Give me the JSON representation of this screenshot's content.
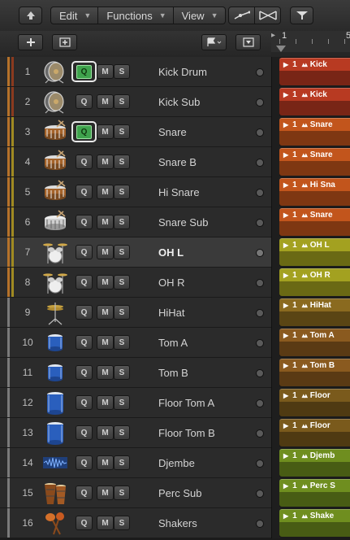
{
  "toolbar": {
    "menus": [
      {
        "label": "Edit"
      },
      {
        "label": "Functions"
      },
      {
        "label": "View"
      }
    ]
  },
  "ruler": {
    "marks": [
      "1",
      "5"
    ]
  },
  "colors": {
    "orange_region": "#c2551c",
    "red_region": "#b83a22",
    "yellow_region": "#a3a120",
    "brown_region": "#8a5a1f",
    "green_region": "#6f8e1f",
    "q_active": "#3fa34d"
  },
  "tracks": [
    {
      "num": "1",
      "name": "Kick Drum",
      "icon": "kick-drum-icon",
      "q_on": true,
      "region": "Kick",
      "region_color": "#b83a22",
      "strips": [
        "#b5722a",
        "#8a3a1f"
      ]
    },
    {
      "num": "2",
      "name": "Kick Sub",
      "icon": "kick-drum-icon",
      "q_on": false,
      "region": "Kick",
      "region_color": "#b83a22",
      "strips": [
        "#b5722a",
        "#8a3a1f"
      ]
    },
    {
      "num": "3",
      "name": "Snare",
      "icon": "snare-drum-icon",
      "q_on": true,
      "region": "Snare",
      "region_color": "#c2551c",
      "strips": [
        "#b5722a",
        "#a08a22"
      ]
    },
    {
      "num": "4",
      "name": "Snare B",
      "icon": "snare-drum-icon",
      "q_on": false,
      "region": "Snare",
      "region_color": "#c2551c",
      "strips": [
        "#b5722a",
        "#a08a22"
      ]
    },
    {
      "num": "5",
      "name": "Hi Snare",
      "icon": "snare-drum-icon",
      "q_on": false,
      "region": "Hi Sna",
      "region_color": "#c2551c",
      "strips": [
        "#b5722a",
        "#a08a22"
      ]
    },
    {
      "num": "6",
      "name": "Snare Sub",
      "icon": "snare-drum-white-icon",
      "q_on": false,
      "region": "Snare",
      "region_color": "#c2551c",
      "strips": [
        "#b5722a",
        "#a08a22"
      ]
    },
    {
      "num": "7",
      "name": "OH L",
      "icon": "drum-kit-icon",
      "q_on": false,
      "region": "OH L",
      "region_color": "#a3a120",
      "strips": [
        "#b5722a",
        "#a08a22"
      ],
      "selected": true
    },
    {
      "num": "8",
      "name": "OH R",
      "icon": "drum-kit-icon",
      "q_on": false,
      "region": "OH R",
      "region_color": "#a3a120",
      "strips": [
        "#b5722a",
        "#a08a22"
      ]
    },
    {
      "num": "9",
      "name": "HiHat",
      "icon": "hihat-icon",
      "q_on": false,
      "region": "HiHat",
      "region_color": "#8a6a1f",
      "strips": [
        "#7a7a7a",
        ""
      ]
    },
    {
      "num": "10",
      "name": "Tom A",
      "icon": "tom-icon",
      "q_on": false,
      "region": "Tom A",
      "region_color": "#8a5a1f",
      "strips": [
        "#7a7a7a",
        ""
      ]
    },
    {
      "num": "11",
      "name": "Tom B",
      "icon": "tom-icon",
      "q_on": false,
      "region": "Tom B",
      "region_color": "#8a5a1f",
      "strips": [
        "#7a7a7a",
        ""
      ]
    },
    {
      "num": "12",
      "name": "Floor Tom A",
      "icon": "floor-tom-icon",
      "q_on": false,
      "region": "Floor",
      "region_color": "#7a5a1c",
      "strips": [
        "#7a7a7a",
        ""
      ]
    },
    {
      "num": "13",
      "name": "Floor Tom B",
      "icon": "floor-tom-icon",
      "q_on": false,
      "region": "Floor",
      "region_color": "#7a5a1c",
      "strips": [
        "#7a7a7a",
        ""
      ]
    },
    {
      "num": "14",
      "name": "Djembe",
      "icon": "waveform-icon",
      "q_on": false,
      "region": "Djemb",
      "region_color": "#6f8e1f",
      "strips": [
        "#7a7a7a",
        ""
      ]
    },
    {
      "num": "15",
      "name": "Perc Sub",
      "icon": "bongos-icon",
      "q_on": false,
      "region": "Perc S",
      "region_color": "#6f8e1f",
      "strips": [
        "#7a7a7a",
        ""
      ]
    },
    {
      "num": "16",
      "name": "Shakers",
      "icon": "maracas-icon",
      "q_on": false,
      "region": "Shake",
      "region_color": "#6f8e1f",
      "strips": [
        "#7a7a7a",
        ""
      ]
    }
  ],
  "buttons": {
    "q": "Q",
    "m": "M",
    "s": "S"
  },
  "region_loop": "1"
}
